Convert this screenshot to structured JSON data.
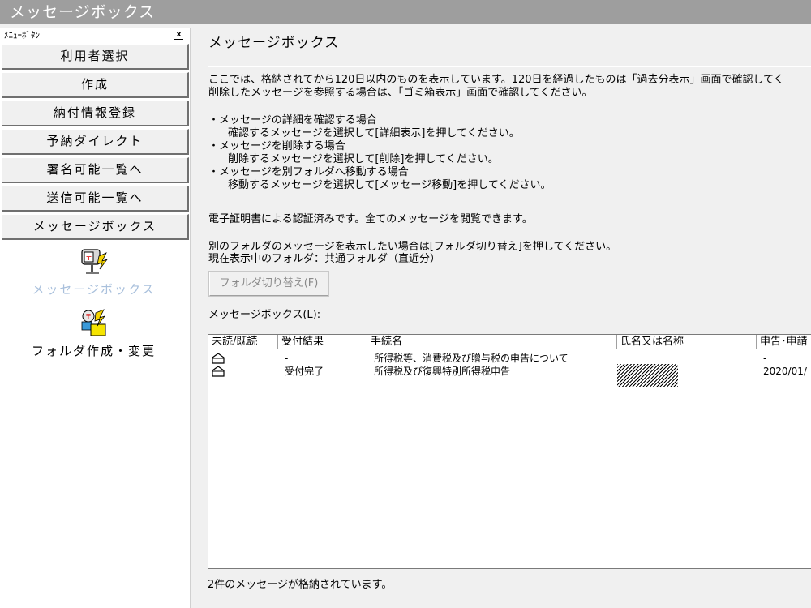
{
  "window": {
    "title": "メッセージボックス"
  },
  "sidebar": {
    "header": "ﾒﾆｭｰﾎﾞﾀﾝ",
    "close_glyph": "x",
    "buttons": [
      "利用者選択",
      "作成",
      "納付情報登録",
      "予納ダイレクト",
      "署名可能一覧へ",
      "送信可能一覧へ",
      "メッセージボックス"
    ],
    "icon_items": [
      {
        "label": "メッセージボックス",
        "icon": "mailbox-icon",
        "color": "#a9c0dc"
      },
      {
        "label": "フォルダ作成・変更",
        "icon": "folder-icon",
        "color": "#000000"
      }
    ]
  },
  "main": {
    "title": "メッセージボックス",
    "intro_1": "ここでは、格納されてから120日以内のものを表示しています。120日を経過したものは「過去分表示」画面で確認してく",
    "intro_2": "削除したメッセージを参照する場合は、「ゴミ箱表示」画面で確認してください。",
    "b1": "・メッセージの詳細を確認する場合",
    "b1_sub": "確認するメッセージを選択して[詳細表示]を押してください。",
    "b2": "・メッセージを削除する場合",
    "b2_sub": "削除するメッセージを選択して[削除]を押してください。",
    "b3": "・メッセージを別フォルダへ移動する場合",
    "b3_sub": "移動するメッセージを選択して[メッセージ移動]を押してください。",
    "cert_note": "電子証明書による認証済みです。全てのメッセージを閲覧できます。",
    "folder_note_1": "別のフォルダのメッセージを表示したい場合は[フォルダ切り替え]を押してください。",
    "folder_note_2": "現在表示中のフォルダ：共通フォルダ（直近分）",
    "switch_button": "フォルダ切り替え(F)",
    "list_label": "メッセージボックス(L):",
    "columns": [
      "未読/既読",
      "受付結果",
      "手続名",
      "氏名又は名称",
      "申告･申請"
    ],
    "rows": [
      {
        "result": "-",
        "procedure": "所得税等、消費税及び贈与税の申告について",
        "name": "",
        "date": "-"
      },
      {
        "result": "受付完了",
        "procedure": "所得税及び復興特別所得税申告",
        "name": "",
        "date": "2020/01/"
      }
    ],
    "footer": "2件のメッセージが格納されています。"
  }
}
